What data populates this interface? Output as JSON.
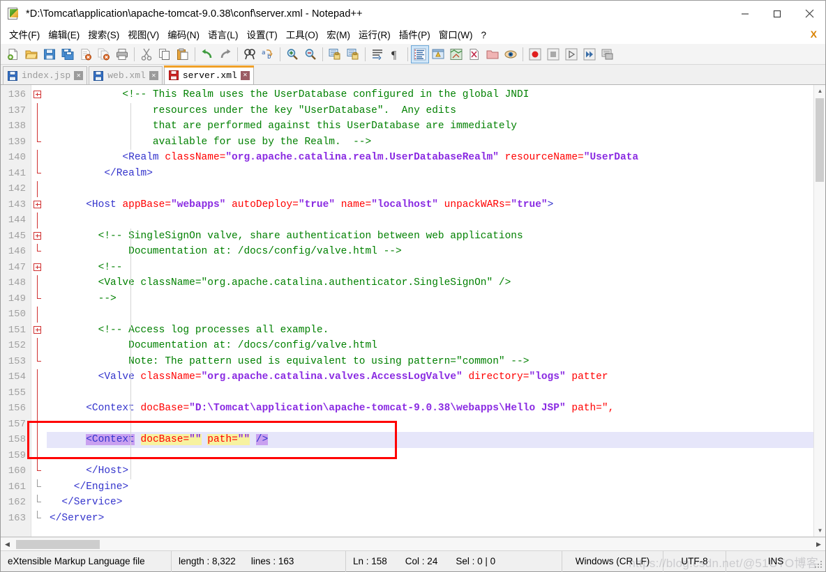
{
  "window": {
    "title": "*D:\\Tomcat\\application\\apache-tomcat-9.0.38\\conf\\server.xml - Notepad++",
    "app_icon": "notepad-plus-plus-icon",
    "controls": {
      "minimize": "minimize-icon",
      "maximize": "maximize-icon",
      "close": "close-icon"
    }
  },
  "menu": {
    "items": [
      {
        "label": "文件(F)",
        "name": "menu-file"
      },
      {
        "label": "编辑(E)",
        "name": "menu-edit"
      },
      {
        "label": "搜索(S)",
        "name": "menu-search"
      },
      {
        "label": "视图(V)",
        "name": "menu-view"
      },
      {
        "label": "编码(N)",
        "name": "menu-encoding"
      },
      {
        "label": "语言(L)",
        "name": "menu-language"
      },
      {
        "label": "设置(T)",
        "name": "menu-settings"
      },
      {
        "label": "工具(O)",
        "name": "menu-tools"
      },
      {
        "label": "宏(M)",
        "name": "menu-macro"
      },
      {
        "label": "运行(R)",
        "name": "menu-run"
      },
      {
        "label": "插件(P)",
        "name": "menu-plugins"
      },
      {
        "label": "窗口(W)",
        "name": "menu-window"
      },
      {
        "label": "?",
        "name": "menu-help"
      }
    ],
    "close_document_x": "X"
  },
  "toolbar": {
    "groups": [
      [
        "new-file-icon",
        "open-file-icon",
        "save-icon",
        "save-all-icon",
        "close-file-icon",
        "close-all-files-icon",
        "print-icon"
      ],
      [
        "cut-icon",
        "copy-icon",
        "paste-icon"
      ],
      [
        "undo-icon",
        "redo-icon"
      ],
      [
        "find-icon",
        "replace-icon"
      ],
      [
        "zoom-in-icon",
        "zoom-out-icon"
      ],
      [
        "sync-vertical-scroll-icon",
        "sync-horizontal-scroll-icon"
      ],
      [
        "word-wrap-icon",
        "show-all-characters-icon"
      ],
      [
        "indent-guideline-icon",
        "user-defined-dialog-icon",
        "document-map-icon",
        "function-list-icon",
        "folder-as-workspace-icon",
        "monitoring-icon"
      ],
      [
        "record-macro-icon",
        "stop-recording-icon",
        "playback-macro-icon",
        "run-macro-multiple-icon",
        "save-macro-icon"
      ]
    ]
  },
  "tabs": [
    {
      "label": "index.jsp",
      "active": false,
      "modified": false,
      "icon": "saved-document-icon",
      "close": "close-tab-icon"
    },
    {
      "label": "web.xml",
      "active": false,
      "modified": false,
      "icon": "saved-document-icon",
      "close": "close-tab-icon"
    },
    {
      "label": "server.xml",
      "active": true,
      "modified": true,
      "icon": "unsaved-document-icon",
      "close": "close-tab-icon"
    }
  ],
  "editor": {
    "first_line": 136,
    "current_line": 158,
    "lines": [
      {
        "num": 136,
        "indent": 0,
        "fold": "open",
        "guides": [],
        "tokens": [
          {
            "t": "comment",
            "s": "            <!-- This Realm uses the UserDatabase configured in the global JNDI"
          }
        ]
      },
      {
        "num": 137,
        "indent": 0,
        "fold": "none",
        "guides": [
          120
        ],
        "tokens": [
          {
            "t": "comment",
            "s": "                 resources under the key \"UserDatabase\".  Any edits"
          }
        ]
      },
      {
        "num": 138,
        "indent": 0,
        "fold": "none",
        "guides": [
          120
        ],
        "tokens": [
          {
            "t": "comment",
            "s": "                 that are performed against this UserDatabase are immediately"
          }
        ]
      },
      {
        "num": 139,
        "indent": 0,
        "fold": "close",
        "guides": [
          120
        ],
        "tokens": [
          {
            "t": "comment",
            "s": "                 available for use by the Realm.  -->"
          }
        ]
      },
      {
        "num": 140,
        "indent": 0,
        "fold": "none",
        "guides": [],
        "tokens": [
          {
            "t": "plain",
            "s": "            "
          },
          {
            "t": "tag",
            "s": "<Realm "
          },
          {
            "t": "attr",
            "s": "className="
          },
          {
            "t": "val",
            "s": "\"org.apache.catalina.realm.UserDatabaseRealm\""
          },
          {
            "t": "plain",
            "s": " "
          },
          {
            "t": "attr",
            "s": "resourceName="
          },
          {
            "t": "val",
            "s": "\"UserData"
          }
        ]
      },
      {
        "num": 141,
        "indent": 0,
        "fold": "close",
        "guides": [],
        "tokens": [
          {
            "t": "tag",
            "s": "         </Realm>"
          }
        ]
      },
      {
        "num": 142,
        "indent": 0,
        "fold": "none",
        "guides": [],
        "tokens": []
      },
      {
        "num": 143,
        "indent": 0,
        "fold": "open",
        "guides": [],
        "tokens": [
          {
            "t": "plain",
            "s": "      "
          },
          {
            "t": "tag",
            "s": "<Host "
          },
          {
            "t": "attr",
            "s": "appBase="
          },
          {
            "t": "val",
            "s": "\"webapps\""
          },
          {
            "t": "plain",
            "s": " "
          },
          {
            "t": "attr",
            "s": "autoDeploy="
          },
          {
            "t": "val",
            "s": "\"true\""
          },
          {
            "t": "plain",
            "s": " "
          },
          {
            "t": "attr",
            "s": "name="
          },
          {
            "t": "val",
            "s": "\"localhost\""
          },
          {
            "t": "plain",
            "s": " "
          },
          {
            "t": "attr",
            "s": "unpackWARs="
          },
          {
            "t": "val",
            "s": "\"true\""
          },
          {
            "t": "tag",
            "s": ">"
          }
        ]
      },
      {
        "num": 144,
        "indent": 0,
        "fold": "none",
        "guides": [],
        "tokens": []
      },
      {
        "num": 145,
        "indent": 0,
        "fold": "open",
        "guides": [
          120
        ],
        "tokens": [
          {
            "t": "comment",
            "s": "        <!-- SingleSignOn valve, share authentication between web applications"
          }
        ]
      },
      {
        "num": 146,
        "indent": 0,
        "fold": "close",
        "guides": [
          120
        ],
        "tokens": [
          {
            "t": "comment",
            "s": "             Documentation at: /docs/config/valve.html -->"
          }
        ]
      },
      {
        "num": 147,
        "indent": 0,
        "fold": "open",
        "guides": [
          120
        ],
        "tokens": [
          {
            "t": "comment",
            "s": "        <!--"
          }
        ]
      },
      {
        "num": 148,
        "indent": 0,
        "fold": "none",
        "guides": [
          120
        ],
        "tokens": [
          {
            "t": "comment",
            "s": "        <Valve className=\"org.apache.catalina.authenticator.SingleSignOn\" />"
          }
        ]
      },
      {
        "num": 149,
        "indent": 0,
        "fold": "close",
        "guides": [
          120
        ],
        "tokens": [
          {
            "t": "comment",
            "s": "        -->"
          }
        ]
      },
      {
        "num": 150,
        "indent": 0,
        "fold": "none",
        "guides": [
          120
        ],
        "tokens": []
      },
      {
        "num": 151,
        "indent": 0,
        "fold": "open",
        "guides": [
          120
        ],
        "tokens": [
          {
            "t": "comment",
            "s": "        <!-- Access log processes all example."
          }
        ]
      },
      {
        "num": 152,
        "indent": 0,
        "fold": "none",
        "guides": [
          120
        ],
        "tokens": [
          {
            "t": "comment",
            "s": "             Documentation at: /docs/config/valve.html"
          }
        ]
      },
      {
        "num": 153,
        "indent": 0,
        "fold": "close",
        "guides": [
          120
        ],
        "tokens": [
          {
            "t": "comment",
            "s": "             Note: The pattern used is equivalent to using pattern=\"common\" -->"
          }
        ]
      },
      {
        "num": 154,
        "indent": 0,
        "fold": "none",
        "guides": [
          120
        ],
        "tokens": [
          {
            "t": "plain",
            "s": "        "
          },
          {
            "t": "tag",
            "s": "<Valve "
          },
          {
            "t": "attr",
            "s": "className="
          },
          {
            "t": "val",
            "s": "\"org.apache.catalina.valves.AccessLogValve\""
          },
          {
            "t": "plain",
            "s": " "
          },
          {
            "t": "attr",
            "s": "directory="
          },
          {
            "t": "val",
            "s": "\"logs\""
          },
          {
            "t": "plain",
            "s": " "
          },
          {
            "t": "attr",
            "s": "patter"
          }
        ]
      },
      {
        "num": 155,
        "indent": 0,
        "fold": "none",
        "guides": [
          120
        ],
        "tokens": []
      },
      {
        "num": 156,
        "indent": 0,
        "fold": "none",
        "guides": [
          120
        ],
        "tokens": [
          {
            "t": "plain",
            "s": "      "
          },
          {
            "t": "tag",
            "s": "<Context "
          },
          {
            "t": "attr",
            "s": "docBase="
          },
          {
            "t": "val",
            "s": "\"D:\\Tomcat\\application\\apache-tomcat-9.0.38\\webapps\\Hello JSP\""
          },
          {
            "t": "plain",
            "s": " "
          },
          {
            "t": "attr",
            "s": "path=\","
          }
        ]
      },
      {
        "num": 157,
        "indent": 0,
        "fold": "none",
        "guides": [
          120
        ],
        "tokens": []
      },
      {
        "num": 158,
        "indent": 0,
        "fold": "none",
        "guides": [
          120
        ],
        "current": true,
        "tokens": [
          {
            "t": "plain",
            "s": "      "
          },
          {
            "t": "tag",
            "s": "<Context",
            "hl": "tagmatch"
          },
          {
            "t": "plain",
            "s": " "
          },
          {
            "t": "attr",
            "s": "docBase=",
            "hl": "attrmatch"
          },
          {
            "t": "val",
            "s": "\"\"",
            "hl": "attrmatch"
          },
          {
            "t": "plain",
            "s": " "
          },
          {
            "t": "attr",
            "s": "path=",
            "hl": "attrmatch"
          },
          {
            "t": "val",
            "s": "\"\"",
            "hl": "attrmatch"
          },
          {
            "t": "plain",
            "s": " "
          },
          {
            "t": "tag",
            "s": "/>",
            "hl": "tagmatch"
          }
        ]
      },
      {
        "num": 159,
        "indent": 0,
        "fold": "none",
        "guides": [
          120
        ],
        "tokens": []
      },
      {
        "num": 160,
        "indent": 0,
        "fold": "close",
        "guides": [
          120
        ],
        "tokens": [
          {
            "t": "tag",
            "s": "      </Host>"
          }
        ]
      },
      {
        "num": 161,
        "indent": 0,
        "fold": "close-gray",
        "guides": [],
        "tokens": [
          {
            "t": "tag",
            "s": "    </Engine>"
          }
        ]
      },
      {
        "num": 162,
        "indent": 0,
        "fold": "close-gray",
        "guides": [],
        "tokens": [
          {
            "t": "tag",
            "s": "  </Service>"
          }
        ]
      },
      {
        "num": 163,
        "indent": 0,
        "fold": "close-gray",
        "guides": [],
        "tokens": [
          {
            "t": "tag",
            "s": "</Server>"
          }
        ]
      }
    ]
  },
  "annotation": {
    "shape": "rectangle",
    "color": "#ff0000",
    "target_line": 158
  },
  "statusbar": {
    "doc_type": "eXtensible Markup Language file",
    "length_label": "length : 8,322",
    "lines_label": "lines : 163",
    "ln": "Ln : 158",
    "col": "Col : 24",
    "sel": "Sel : 0 | 0",
    "eol": "Windows (CR LF)",
    "encoding": "UTF-8",
    "insert_mode": "INS"
  },
  "watermark": {
    "text": "https://blog.csdn.net/@51CTO博客"
  },
  "colors": {
    "comment": "#008000",
    "tag": "#3333cc",
    "attribute": "#ff0000",
    "value": "#8a2be2",
    "current_line_bg": "#e6e6fa",
    "tag_match_hl": "#c9a0f0",
    "attr_match_hl": "#f7f2a0",
    "active_tab_accent": "#f0a028",
    "annotation": "#ff0000"
  }
}
